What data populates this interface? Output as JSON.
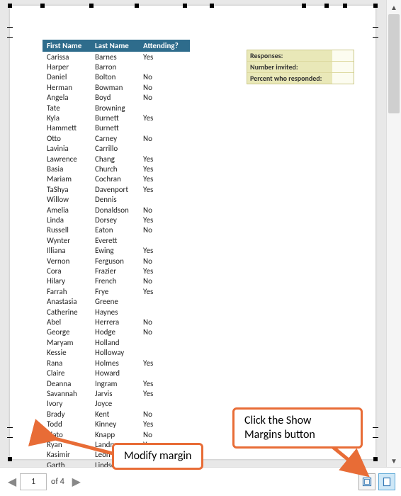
{
  "header": {
    "col_first": "First Name",
    "col_last": "Last Name",
    "col_att": "Attending?"
  },
  "rows": [
    {
      "f": "Carissa",
      "l": "Barnes",
      "a": "Yes"
    },
    {
      "f": "Harper",
      "l": "Barron",
      "a": ""
    },
    {
      "f": "Daniel",
      "l": "Bolton",
      "a": "No"
    },
    {
      "f": "Herman",
      "l": "Bowman",
      "a": "No"
    },
    {
      "f": "Angela",
      "l": "Boyd",
      "a": "No"
    },
    {
      "f": "Tate",
      "l": "Browning",
      "a": ""
    },
    {
      "f": "Kyla",
      "l": "Burnett",
      "a": "Yes"
    },
    {
      "f": "Hammett",
      "l": "Burnett",
      "a": ""
    },
    {
      "f": "Otto",
      "l": "Carney",
      "a": "No"
    },
    {
      "f": "Lavinia",
      "l": "Carrillo",
      "a": ""
    },
    {
      "f": "Lawrence",
      "l": "Chang",
      "a": "Yes"
    },
    {
      "f": "Basia",
      "l": "Church",
      "a": "Yes"
    },
    {
      "f": "Mariam",
      "l": "Cochran",
      "a": "Yes"
    },
    {
      "f": "TaShya",
      "l": "Davenport",
      "a": "Yes"
    },
    {
      "f": "Willow",
      "l": "Dennis",
      "a": ""
    },
    {
      "f": "Amelia",
      "l": "Donaldson",
      "a": "No"
    },
    {
      "f": "Linda",
      "l": "Dorsey",
      "a": "Yes"
    },
    {
      "f": "Russell",
      "l": "Eaton",
      "a": "No"
    },
    {
      "f": "Wynter",
      "l": "Everett",
      "a": ""
    },
    {
      "f": "Illiana",
      "l": "Ewing",
      "a": "Yes"
    },
    {
      "f": "Vernon",
      "l": "Ferguson",
      "a": "No"
    },
    {
      "f": "Cora",
      "l": "Frazier",
      "a": "Yes"
    },
    {
      "f": "Hilary",
      "l": "French",
      "a": "No"
    },
    {
      "f": "Farrah",
      "l": "Frye",
      "a": "Yes"
    },
    {
      "f": "Anastasia",
      "l": "Greene",
      "a": ""
    },
    {
      "f": "Catherine",
      "l": "Haynes",
      "a": ""
    },
    {
      "f": "Abel",
      "l": "Herrera",
      "a": "No"
    },
    {
      "f": "George",
      "l": "Hodge",
      "a": "No"
    },
    {
      "f": "Maryam",
      "l": "Holland",
      "a": ""
    },
    {
      "f": "Kessie",
      "l": "Holloway",
      "a": ""
    },
    {
      "f": "Rana",
      "l": "Holmes",
      "a": "Yes"
    },
    {
      "f": "Claire",
      "l": "Howard",
      "a": ""
    },
    {
      "f": "Deanna",
      "l": "Ingram",
      "a": "Yes"
    },
    {
      "f": "Savannah",
      "l": "Jarvis",
      "a": "Yes"
    },
    {
      "f": "Ivory",
      "l": "Joyce",
      "a": ""
    },
    {
      "f": "Brady",
      "l": "Kent",
      "a": "No"
    },
    {
      "f": "Todd",
      "l": "Kinney",
      "a": "Yes"
    },
    {
      "f": "Plato",
      "l": "Knapp",
      "a": "No"
    },
    {
      "f": "Ryan",
      "l": "Landry",
      "a": "Yes"
    },
    {
      "f": "Kasimir",
      "l": "Leon",
      "a": ""
    },
    {
      "f": "Garth",
      "l": "Lindsey",
      "a": ""
    }
  ],
  "responses": {
    "label_responses": "Responses:",
    "label_invited": "Number invited:",
    "label_percent": "Percent who responded:"
  },
  "pager": {
    "current": "1",
    "of_label": "of 4"
  },
  "callouts": {
    "modify": "Modify margin",
    "show_margins": "Click the Show\nMargins button"
  }
}
